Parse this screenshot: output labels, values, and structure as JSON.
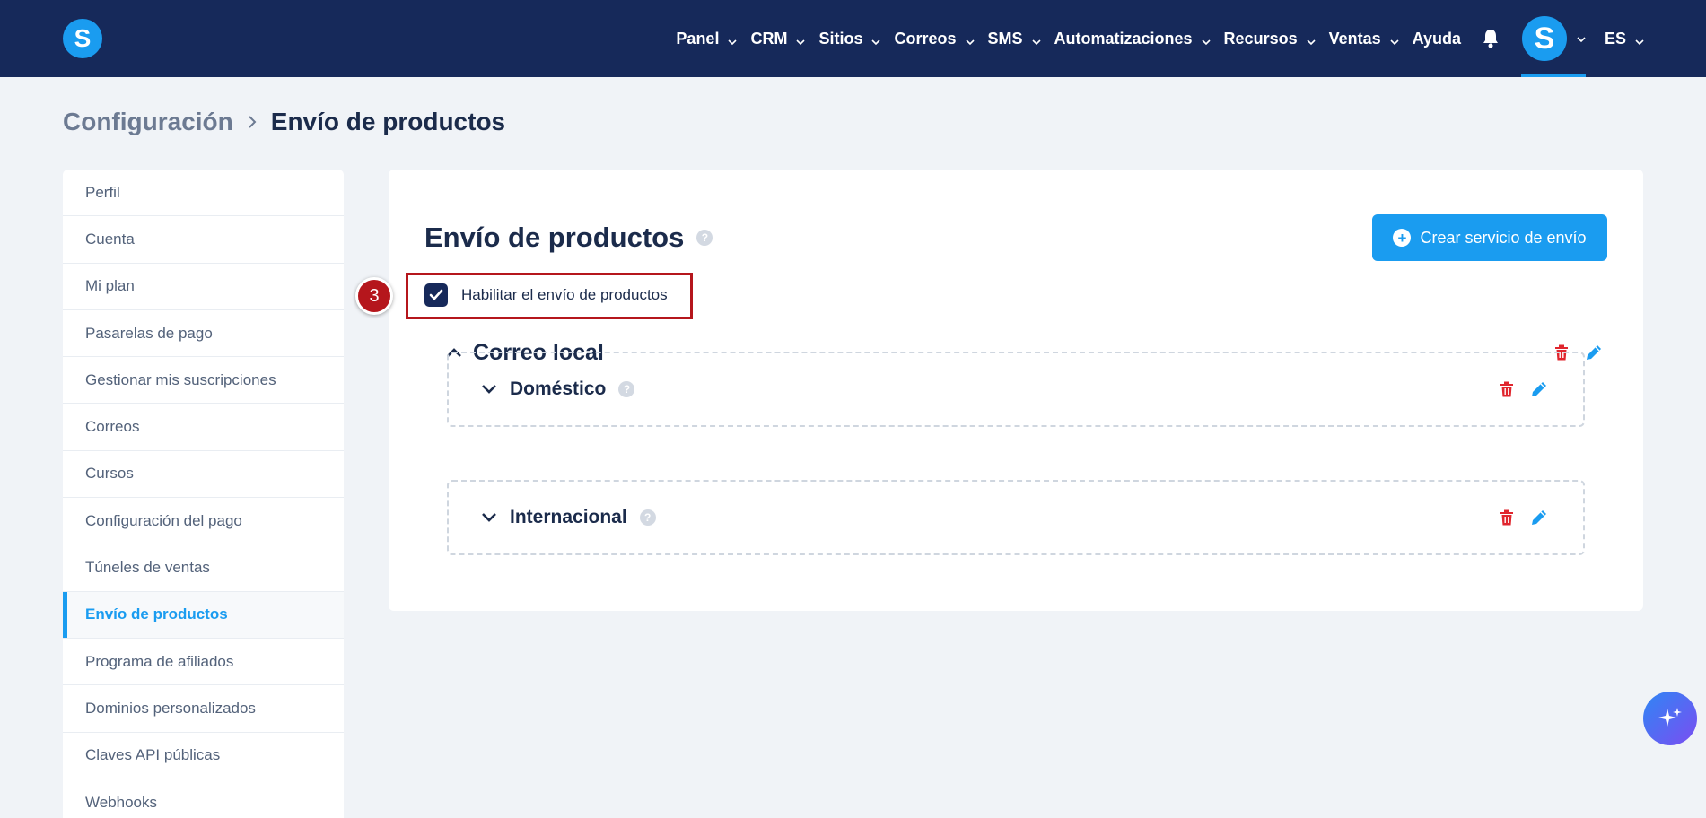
{
  "app": {
    "logo_letter": "S",
    "brand_color": "#1a9cf0",
    "nav_bg": "#16295a"
  },
  "nav": {
    "items": [
      {
        "label": "Panel",
        "has_dropdown": true
      },
      {
        "label": "CRM",
        "has_dropdown": true
      },
      {
        "label": "Sitios",
        "has_dropdown": true
      },
      {
        "label": "Correos",
        "has_dropdown": true
      },
      {
        "label": "SMS",
        "has_dropdown": true
      },
      {
        "label": "Automatizaciones",
        "has_dropdown": true
      },
      {
        "label": "Recursos",
        "has_dropdown": true
      },
      {
        "label": "Ventas",
        "has_dropdown": true
      },
      {
        "label": "Ayuda",
        "has_dropdown": false
      }
    ],
    "avatar_letter": "S",
    "language": "ES",
    "icons": [
      "bell-icon",
      "chevron-down-icon"
    ]
  },
  "breadcrumb": {
    "parent": "Configuración",
    "current": "Envío de productos"
  },
  "sidebar": {
    "items": [
      {
        "label": "Perfil"
      },
      {
        "label": "Cuenta"
      },
      {
        "label": "Mi plan"
      },
      {
        "label": "Pasarelas de pago"
      },
      {
        "label": "Gestionar mis suscripciones"
      },
      {
        "label": "Correos"
      },
      {
        "label": "Cursos"
      },
      {
        "label": "Configuración del pago"
      },
      {
        "label": "Túneles de ventas"
      },
      {
        "label": "Envío de productos",
        "active": true
      },
      {
        "label": "Programa de afiliados"
      },
      {
        "label": "Dominios personalizados"
      },
      {
        "label": "Claves API públicas"
      },
      {
        "label": "Webhooks"
      }
    ]
  },
  "main": {
    "title": "Envío de productos",
    "help_glyph": "?",
    "create_button": "Crear servicio de envío",
    "enable_checkbox": {
      "label": "Habilitar el envío de productos",
      "checked": true
    },
    "annotation": {
      "step": "3",
      "color": "#b5161c"
    },
    "service": {
      "name": "Correo local",
      "expanded": true,
      "zones": [
        {
          "name": "Doméstico"
        },
        {
          "name": "Internacional"
        }
      ]
    },
    "colors": {
      "delete": "#e0262e",
      "edit": "#1a9cf0"
    }
  }
}
